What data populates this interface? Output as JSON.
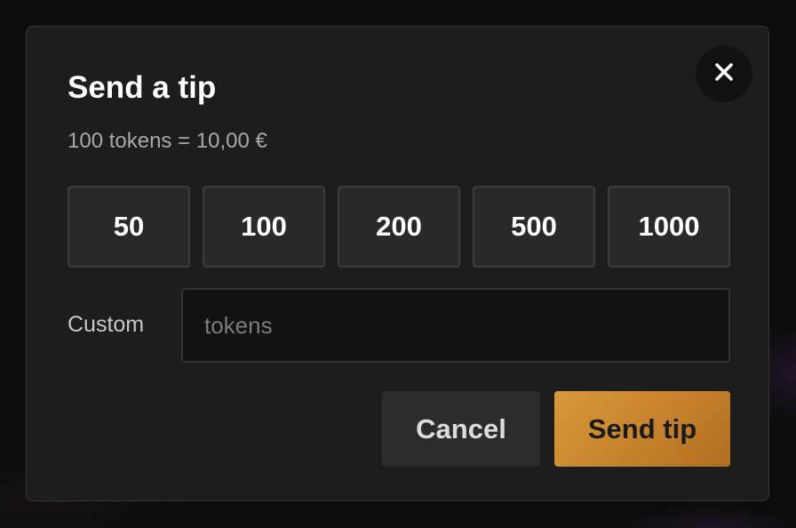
{
  "dialog": {
    "title": "Send a tip",
    "rate_text": "100 tokens = 10,00 €",
    "close_icon": "close-icon",
    "presets": [
      {
        "label": "50"
      },
      {
        "label": "100"
      },
      {
        "label": "200"
      },
      {
        "label": "500"
      },
      {
        "label": "1000"
      }
    ],
    "custom": {
      "label": "Custom",
      "placeholder": "tokens",
      "value": ""
    },
    "buttons": {
      "cancel": "Cancel",
      "send": "Send tip"
    },
    "colors": {
      "accent": "#c98a30",
      "modal_bg": "#1d1d1d",
      "preset_bg": "#292929",
      "input_bg": "#121212"
    }
  }
}
